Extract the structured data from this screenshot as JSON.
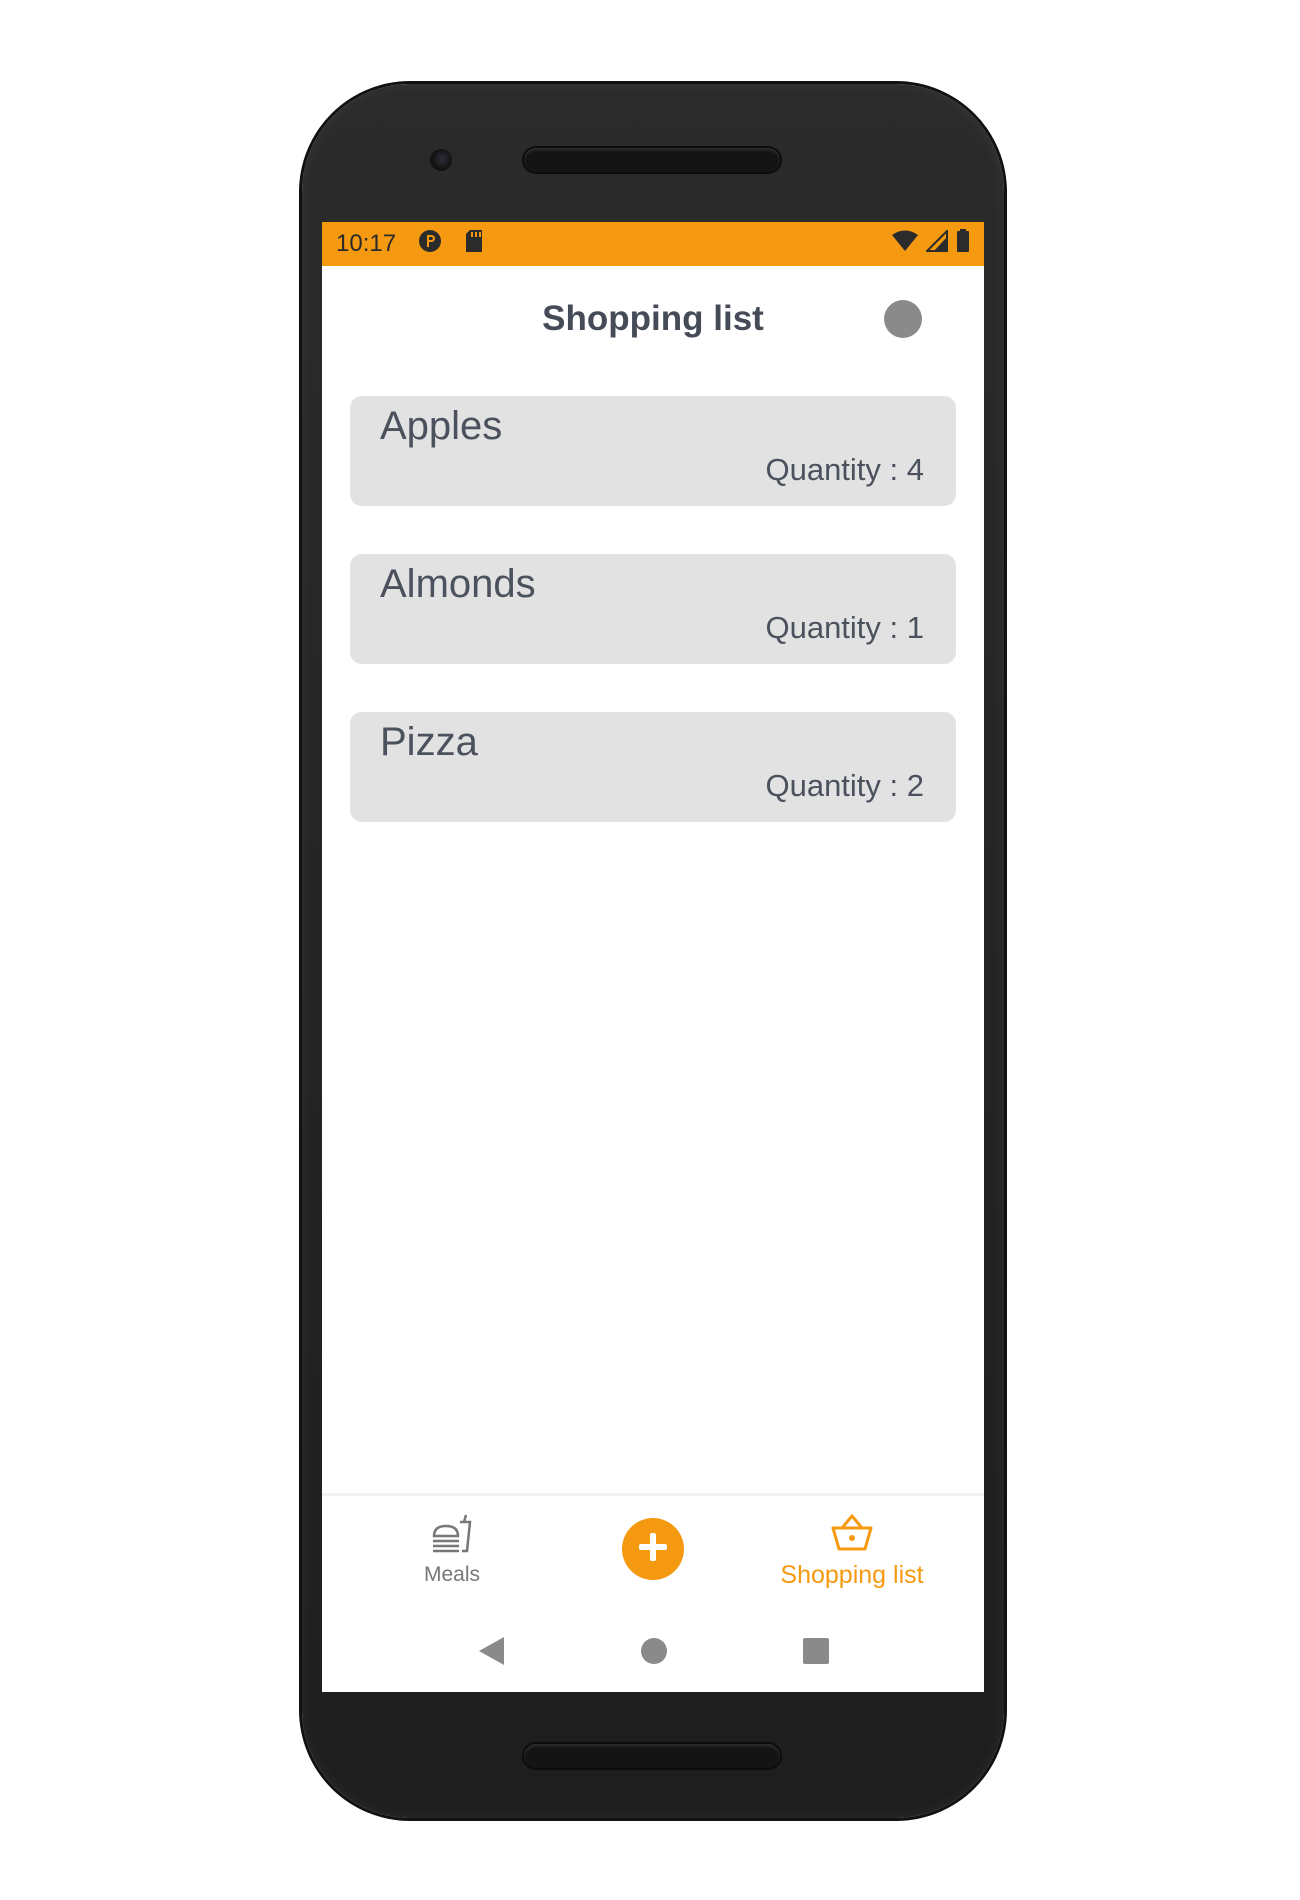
{
  "status_bar": {
    "time": "10:17",
    "background_color": "#f59a10",
    "left_icons": [
      "p-badge-icon",
      "sd-card-icon"
    ],
    "right_icons": [
      "wifi-icon",
      "cell-signal-icon",
      "battery-icon"
    ]
  },
  "header": {
    "title": "Shopping list",
    "action_icon": "profile-dot-icon"
  },
  "shopping_list": {
    "items": [
      {
        "name": "Apples",
        "quantity_text": "Quantity : 4"
      },
      {
        "name": "Almonds",
        "quantity_text": "Quantity : 1"
      },
      {
        "name": "Pizza",
        "quantity_text": "Quantity : 2"
      }
    ]
  },
  "bottom_nav": {
    "meals_label": "Meals",
    "meals_icon": "meals-icon",
    "add_icon": "plus-icon",
    "shopping_label": "Shopping list",
    "shopping_icon": "basket-icon",
    "active": "Shopping list",
    "accent_color": "#f59a10",
    "inactive_color": "#777777"
  },
  "system_nav": {
    "icons": [
      "back-icon",
      "home-icon",
      "recents-icon"
    ]
  }
}
